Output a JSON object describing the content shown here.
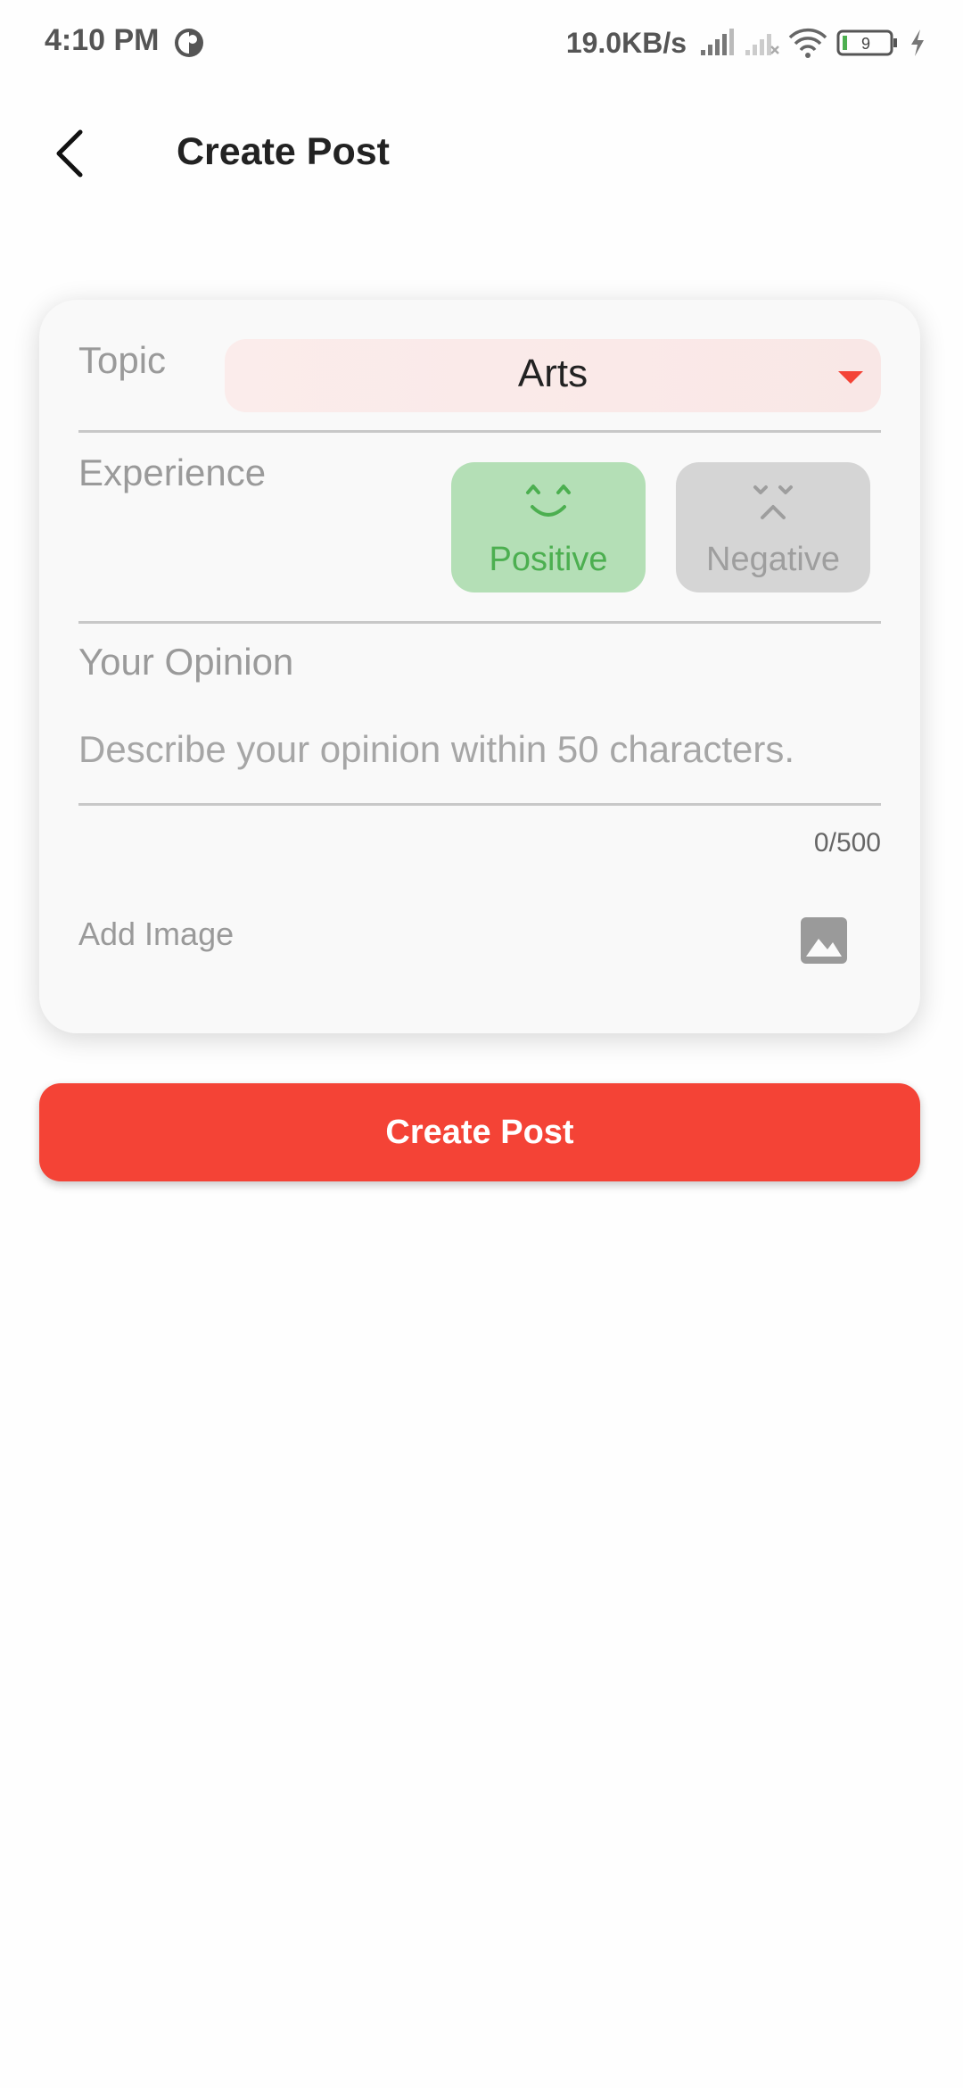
{
  "status_bar": {
    "time": "4:10 PM",
    "network_speed": "19.0KB/s",
    "battery_level": "9",
    "icons": [
      "app-notification-icon",
      "signal-icon",
      "signal-no-service-icon",
      "wifi-icon",
      "battery-icon",
      "charging-icon"
    ]
  },
  "header": {
    "back_icon": "back-arrow-icon",
    "title": "Create Post"
  },
  "form": {
    "topic": {
      "label": "Topic",
      "selected": "Arts",
      "icon": "dropdown-triangle-icon"
    },
    "experience": {
      "label": "Experience",
      "options": [
        {
          "label": "Positive",
          "icon": "happy-face-icon",
          "selected": true
        },
        {
          "label": "Negative",
          "icon": "sad-face-icon",
          "selected": false
        }
      ]
    },
    "opinion": {
      "label": "Your Opinion",
      "value": "",
      "placeholder": "Describe your opinion within 50 characters.",
      "counter": "0/500"
    },
    "add_image": {
      "label": "Add Image",
      "icon": "image-icon"
    }
  },
  "actions": {
    "create_label": "Create Post"
  },
  "colors": {
    "accent": "#f44336",
    "positive": "#4caf50",
    "positive_bg": "#b4dfb6",
    "negative_bg": "#d5d5d5",
    "dropdown_bg": "#fbeceb",
    "card_bg": "#f9f9f9"
  }
}
